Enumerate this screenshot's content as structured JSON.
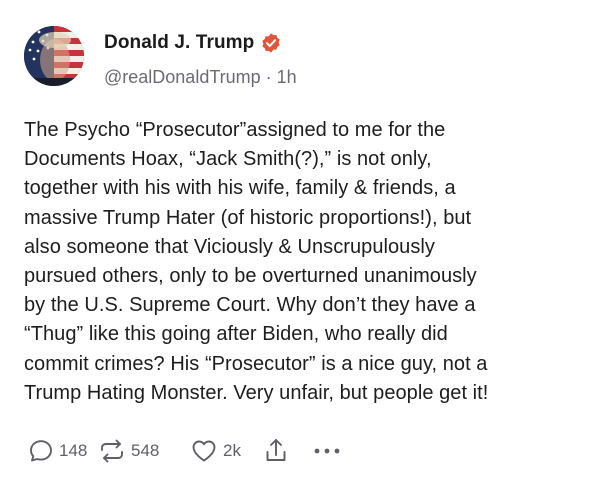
{
  "post": {
    "author": {
      "display_name": "Donald J. Trump",
      "handle": "@realDonaldTrump",
      "separator": "·",
      "time": "1h",
      "verified_icon": "verified-badge-icon",
      "verified_color": "#e0563a",
      "avatar_icon": "avatar-image"
    },
    "text": "The Psycho “Prosecutor”assigned to me for the\nDocuments Hoax, “Jack Smith(?),” is not only,\ntogether with his with his wife, family & friends, a\nmassive Trump Hater (of historic proportions!), but\nalso someone that Viciously & Unscrupulously\npursued others, only to be overturned unanimously\nby the U.S. Supreme Court. Why don’t they have a\n“Thug” like this going after Biden, who really did\ncommit crimes? His “Prosecutor” is a nice guy, not a\nTrump Hating Monster. Very unfair, but people get it!",
    "actions": {
      "replies": "148",
      "retruths": "548",
      "likes": "2k",
      "reply_icon": "reply-bubble-icon",
      "retruth_icon": "retruth-icon",
      "like_icon": "heart-icon",
      "share_icon": "share-icon",
      "more_icon": "more-dots-icon"
    }
  },
  "colors": {
    "text": "#1d1d1f",
    "muted": "#6b6b73",
    "icon": "#5f5f66",
    "accent": "#e0563a"
  }
}
